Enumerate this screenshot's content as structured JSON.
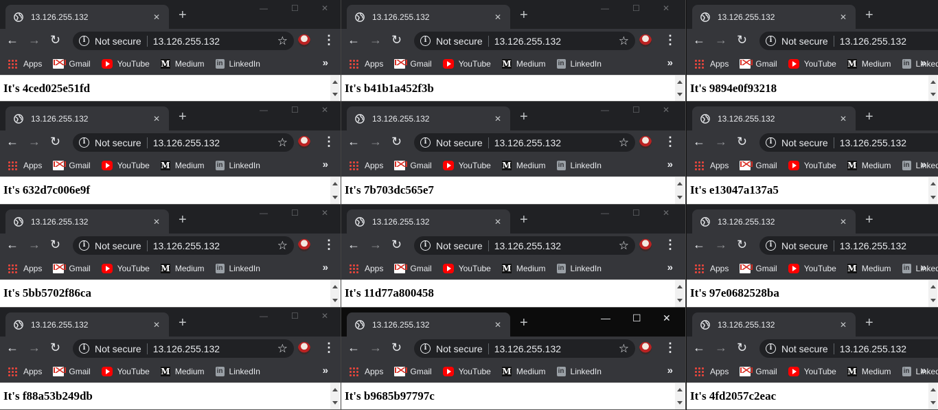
{
  "browser": {
    "tab_title": "13.126.255.132",
    "tab_close": "✕",
    "new_tab": "+",
    "not_secure": "Not secure",
    "url": "13.126.255.132",
    "bookmarks": [
      "Apps",
      "Gmail",
      "YouTube",
      "Medium",
      "LinkedIn"
    ],
    "bookmarks_overflow": "»",
    "icons": {
      "favicon": "globe-icon",
      "back": "arrow-left-icon",
      "forward": "arrow-right-icon",
      "reload": "reload-icon",
      "info": "info-icon",
      "star": "star-icon",
      "menu": "kebab-menu-icon"
    }
  },
  "windows": [
    {
      "message": "It's 4ced025e51fd",
      "active": false
    },
    {
      "message": "It's b41b1a452f3b",
      "active": false
    },
    {
      "message": "It's 9894e0f93218",
      "active": false
    },
    {
      "message": "It's 632d7c006e9f",
      "active": false
    },
    {
      "message": "It's 7b703dc565e7",
      "active": false
    },
    {
      "message": "It's e13047a137a5",
      "active": false
    },
    {
      "message": "It's 5bb5702f86ca",
      "active": false
    },
    {
      "message": "It's 11d77a800458",
      "active": false
    },
    {
      "message": "It's 97e0682528ba",
      "active": false
    },
    {
      "message": "It's f88a53b249db",
      "active": false
    },
    {
      "message": "It's b9685b97797c",
      "active": true
    },
    {
      "message": "It's 4fd2057c2eac",
      "active": false
    }
  ]
}
